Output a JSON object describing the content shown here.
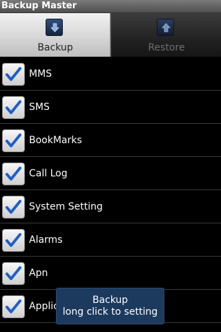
{
  "app": {
    "title": "Backup Master"
  },
  "tabs": [
    {
      "label": "Backup",
      "selected": true,
      "icon": "download-arrow-icon"
    },
    {
      "label": "Restore",
      "selected": false,
      "icon": "upload-arrow-icon"
    }
  ],
  "items": [
    {
      "label": "MMS",
      "checked": true
    },
    {
      "label": "SMS",
      "checked": true
    },
    {
      "label": "BookMarks",
      "checked": true
    },
    {
      "label": "Call Log",
      "checked": true
    },
    {
      "label": "System Setting",
      "checked": true
    },
    {
      "label": "Alarms",
      "checked": true
    },
    {
      "label": "Apn",
      "checked": true
    },
    {
      "label": "Applic",
      "checked": true
    }
  ],
  "toast": {
    "line1": "Backup",
    "line2": "long click to setting"
  },
  "colors": {
    "check": "#1e5fc9",
    "toast_bg": "#1c3a5e"
  }
}
